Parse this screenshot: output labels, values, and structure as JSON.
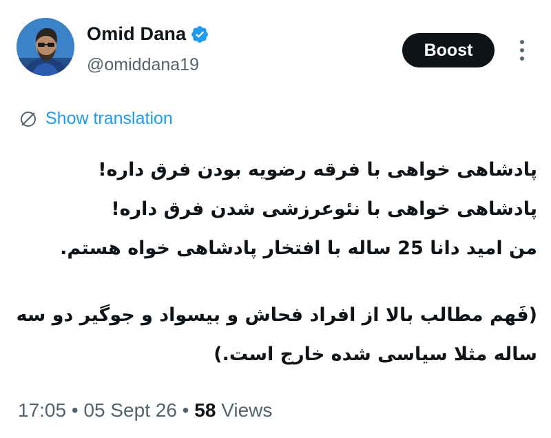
{
  "author": {
    "display_name": "Omid Dana",
    "handle": "@omiddana19",
    "verified": true
  },
  "actions": {
    "boost_label": "Boost",
    "more_icon": "more-vertical-icon"
  },
  "translation": {
    "icon": "globe-translate-icon",
    "label": "Show translation"
  },
  "tweet": {
    "lines": [
      "پادشاهی خواهی با فرقه رضویه بودن فرق داره!",
      "پادشاهی خواهی با نئوعرزشی شدن فرق داره!",
      "من امید دانا 25 ساله با افتخار پادشاهی خواه هستم."
    ],
    "lines_2": [
      "(فَهم مطالب بالا از افراد فحاش و بیسواد و جوگیر دو سه",
      "ساله مثلا سیاسی شده خارج است.)"
    ]
  },
  "meta": {
    "time": "17:05",
    "separator": " • ",
    "date": "05 Sept 26",
    "views_count": "58",
    "views_label": " Views"
  },
  "colors": {
    "text": "#0f1419",
    "secondary": "#536471",
    "link": "#1d9bf0",
    "verified": "#1d9bf0",
    "button_bg": "#0f1419"
  }
}
